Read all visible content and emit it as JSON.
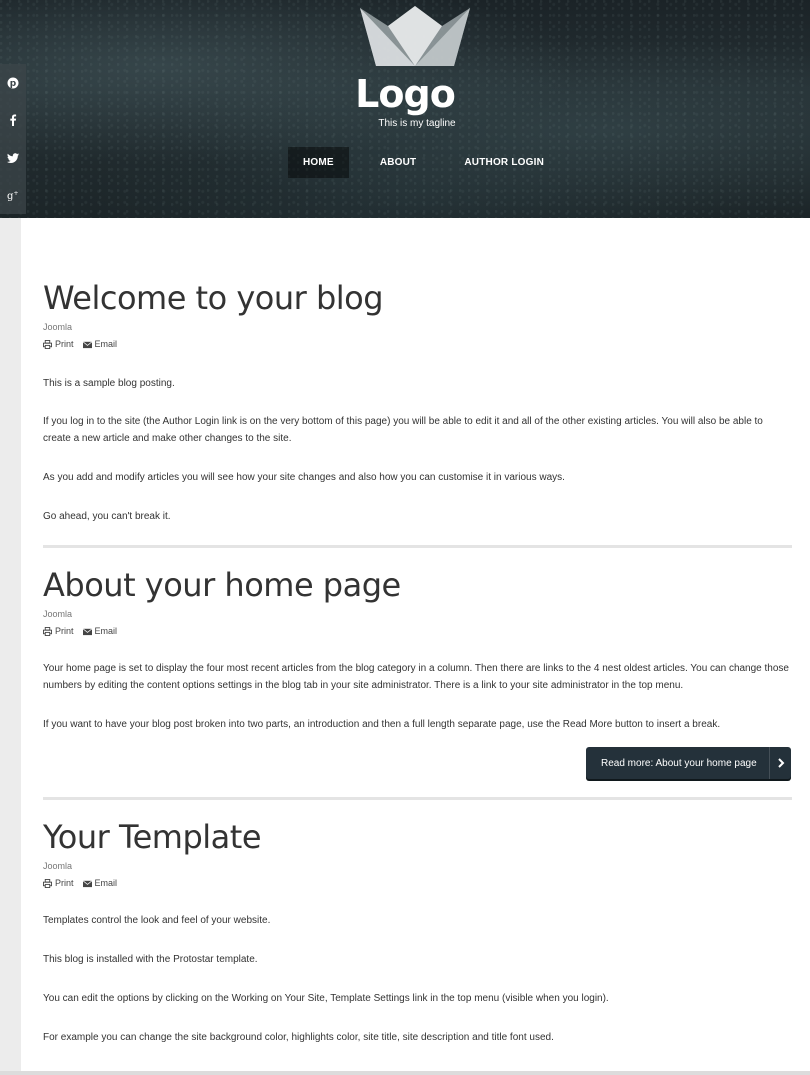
{
  "header": {
    "logo_text": "Logo",
    "tagline": "This is my tagline",
    "nav": [
      {
        "label": "HOME",
        "active": true
      },
      {
        "label": "ABOUT",
        "active": false
      },
      {
        "label": "AUTHOR LOGIN",
        "active": false
      }
    ]
  },
  "social": [
    "pinterest-icon",
    "facebook-icon",
    "twitter-icon",
    "google-plus-icon"
  ],
  "articles": [
    {
      "title": "Welcome to your blog",
      "author": "Joomla",
      "print_label": "Print",
      "email_label": "Email",
      "paragraphs": [
        "This is a sample blog posting.",
        "If you log in to the site (the Author Login link is on the very bottom of this page) you will be able to edit it and all of the other existing articles. You will also be able to create a new article and make other changes to the site.",
        "As you add and modify articles you will see how your site changes and also how you can customise it in various ways.",
        "Go ahead, you can't break it."
      ]
    },
    {
      "title": "About your home page",
      "author": "Joomla",
      "print_label": "Print",
      "email_label": "Email",
      "paragraphs": [
        "Your home page is set to display the four most recent articles from the blog category in a column. Then there are links to the 4 nest oldest articles. You can change those numbers by editing the content options settings in the blog tab in your site administrator. There is a link to your site administrator in the top menu.",
        "If you want to have your blog post broken into two parts, an introduction and then a full length separate page, use the Read More button to insert a break."
      ],
      "read_more": "Read more: About your home page"
    },
    {
      "title": "Your Template",
      "author": "Joomla",
      "print_label": "Print",
      "email_label": "Email",
      "paragraphs": [
        "Templates control the look and feel of your website.",
        "This blog is installed with the Protostar template.",
        "You can edit the options by clicking on the Working on Your Site, Template Settings link in the top menu (visible when you login).",
        "For example you can change the site background color, highlights color, site title, site description and title font used."
      ]
    }
  ]
}
